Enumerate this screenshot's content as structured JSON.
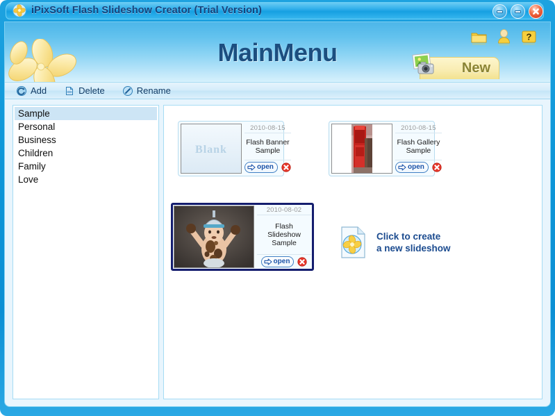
{
  "window": {
    "title": "iPixSoft Flash Slideshow Creator (Trial Version)",
    "controls": {
      "minimize": "minimize-button",
      "maximize": "maximize-button",
      "close": "close-button"
    }
  },
  "header": {
    "title": "MainMenu",
    "new_tab_label": "New",
    "icons": [
      {
        "name": "folder-icon"
      },
      {
        "name": "user-icon"
      },
      {
        "name": "help-icon",
        "glyph": "?"
      }
    ]
  },
  "toolbar": {
    "items": [
      {
        "label": "Add",
        "icon": "add-icon"
      },
      {
        "label": "Delete",
        "icon": "delete-icon"
      },
      {
        "label": "Rename",
        "icon": "rename-icon"
      }
    ]
  },
  "sidebar": {
    "items": [
      {
        "label": "Sample",
        "selected": true
      },
      {
        "label": "Personal",
        "selected": false
      },
      {
        "label": "Business",
        "selected": false
      },
      {
        "label": "Children",
        "selected": false
      },
      {
        "label": "Family",
        "selected": false
      },
      {
        "label": "Love",
        "selected": false
      }
    ]
  },
  "content": {
    "open_label": "open",
    "cards": [
      {
        "date": "2010-08-15",
        "name": "Flash Banner Sample",
        "thumb": "blank-thumbnail",
        "thumb_text": "Blank",
        "selected": false
      },
      {
        "date": "2010-08-15",
        "name": "Flash Gallery Sample",
        "thumb": "red-door-photo-thumbnail",
        "selected": false
      },
      {
        "date": "2010-08-02",
        "name": "Flash Slideshow Sample",
        "thumb": "baby-photo-thumbnail",
        "selected": true
      }
    ],
    "create_new": {
      "line1": "Click to create",
      "line2": "a new slideshow",
      "icon": "new-document-icon"
    }
  },
  "colors": {
    "accent_blue": "#0d96d8",
    "title_text": "#16437c",
    "header_title": "#1c4e7f",
    "selection_border": "#141d6e",
    "selection_row": "#cde5f5",
    "new_tab": "#f9edb4",
    "close_red": "#cf2a12"
  }
}
